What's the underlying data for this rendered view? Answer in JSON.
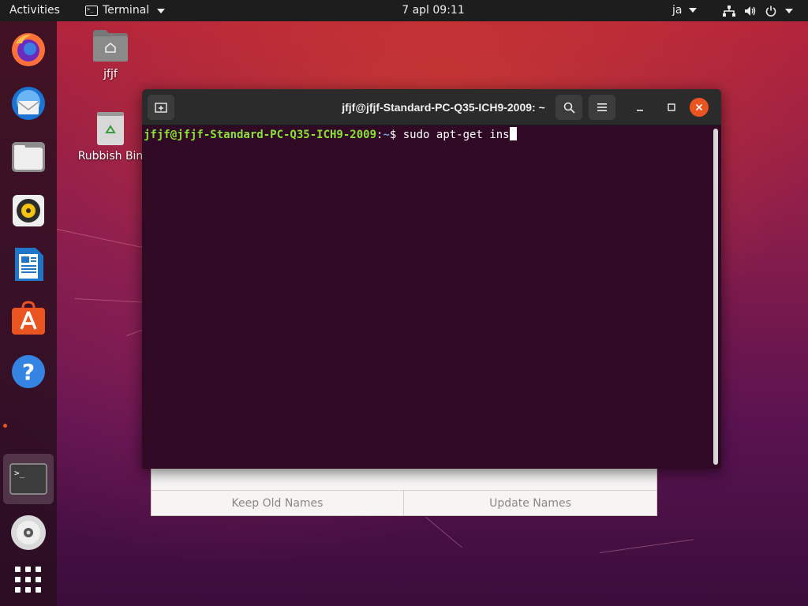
{
  "topbar": {
    "activities": "Activities",
    "app_name": "Terminal",
    "clock": "7 apl  09:11",
    "input_source": "ja"
  },
  "dock": {
    "items": [
      {
        "name": "firefox",
        "icon": "firefox-icon"
      },
      {
        "name": "thunderbird",
        "icon": "thunderbird-icon"
      },
      {
        "name": "files",
        "icon": "files-icon"
      },
      {
        "name": "rhythmbox",
        "icon": "rhythmbox-icon"
      },
      {
        "name": "libreoffice-writer",
        "icon": "writer-icon"
      },
      {
        "name": "ubuntu-software",
        "icon": "software-icon"
      },
      {
        "name": "help",
        "icon": "help-icon"
      },
      {
        "name": "terminal",
        "icon": "terminal-icon",
        "running": true,
        "active": true
      },
      {
        "name": "dvd",
        "icon": "disc-icon"
      },
      {
        "name": "show-applications",
        "icon": "app-grid-icon"
      }
    ]
  },
  "desktop": {
    "home_label": "jfjf",
    "trash_label": "Rubbish Bin"
  },
  "bg_dialog": {
    "keep_label": "Keep Old Names",
    "update_label": "Update Names"
  },
  "terminal": {
    "title": "jfjf@jfjf-Standard-PC-Q35-ICH9-2009: ~",
    "prompt_user": "jfjf@jfjf-Standard-PC-Q35-ICH9-2009",
    "prompt_sep": ":",
    "prompt_path": "~",
    "prompt_symbol": "$ ",
    "command": "sudo apt-get ins"
  },
  "colors": {
    "accent": "#e95420",
    "terminal_bg": "#300a24",
    "prompt_user": "#8ae234",
    "prompt_path": "#729fcf"
  }
}
